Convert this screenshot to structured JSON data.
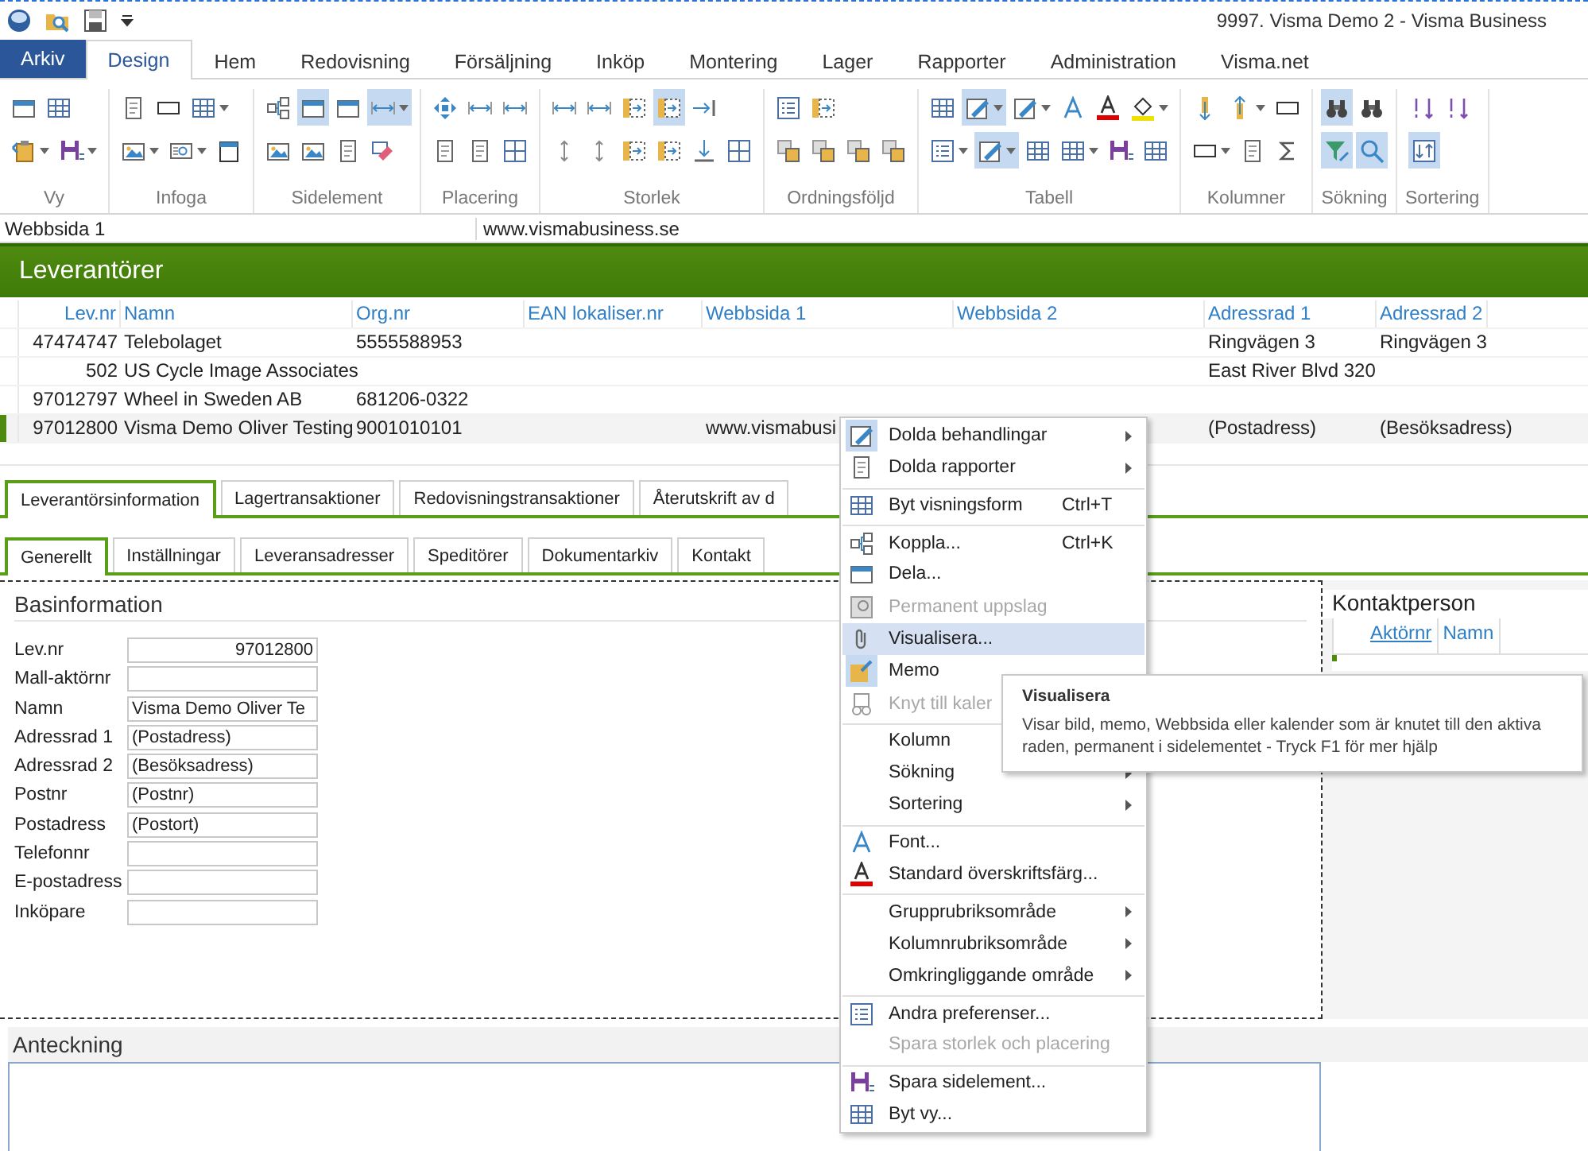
{
  "window": {
    "title": "9997. Visma Demo 2 -  Visma Business"
  },
  "file_tab": {
    "label": "Arkiv"
  },
  "tabs": [
    {
      "label": "Design",
      "selected": true
    },
    {
      "label": "Hem",
      "selected": false
    },
    {
      "label": "Redovisning",
      "selected": false
    },
    {
      "label": "Försäljning",
      "selected": false
    },
    {
      "label": "Inköp",
      "selected": false
    },
    {
      "label": "Montering",
      "selected": false
    },
    {
      "label": "Lager",
      "selected": false
    },
    {
      "label": "Rapporter",
      "selected": false
    },
    {
      "label": "Administration",
      "selected": false
    },
    {
      "label": "Visma.net",
      "selected": false
    }
  ],
  "ribbon": {
    "groups": [
      {
        "label": "Vy",
        "top": [
          {
            "on": false
          },
          {
            "on": false
          }
        ],
        "bottom": [
          {
            "on": false
          },
          {
            "on": false
          }
        ]
      },
      {
        "label": "Infoga",
        "top": [
          {
            "on": false
          },
          {
            "on": false
          },
          {
            "on": false
          }
        ],
        "bottom": [
          {
            "on": false
          },
          {
            "on": false
          },
          {
            "on": false
          }
        ]
      },
      {
        "label": "Sidelement",
        "top": [
          {
            "on": false
          },
          {
            "on": true
          },
          {
            "on": false
          },
          {
            "on": true
          }
        ],
        "bottom": [
          {
            "on": false
          },
          {
            "on": false
          },
          {
            "on": false
          },
          {
            "on": false
          }
        ]
      },
      {
        "label": "Placering",
        "top": [
          {
            "on": false
          },
          {
            "on": false
          },
          {
            "on": false
          }
        ],
        "bottom": [
          {
            "on": false
          },
          {
            "on": false
          },
          {
            "on": false
          }
        ]
      },
      {
        "label": "Storlek",
        "top": [
          {
            "on": false
          },
          {
            "on": false
          },
          {
            "on": false
          },
          {
            "on": true
          },
          {
            "on": false
          }
        ],
        "bottom": [
          {
            "on": false
          },
          {
            "on": false
          },
          {
            "on": false
          },
          {
            "on": false
          },
          {
            "on": false
          },
          {
            "on": false
          }
        ]
      },
      {
        "label": "Ordningsföljd",
        "top": [
          {
            "on": false
          },
          {
            "on": false
          }
        ],
        "bottom": [
          {
            "on": false
          },
          {
            "on": false
          },
          {
            "on": false
          },
          {
            "on": false
          }
        ]
      },
      {
        "label": "Tabell",
        "top": [
          {
            "on": false
          },
          {
            "on": true
          },
          {
            "on": false
          },
          {
            "on": false
          },
          {
            "on": false
          },
          {
            "on": false
          }
        ],
        "bottom": [
          {
            "on": false
          },
          {
            "on": true
          },
          {
            "on": false
          },
          {
            "on": false
          },
          {
            "on": false
          },
          {
            "on": false
          }
        ]
      },
      {
        "label": "Kolumner",
        "top": [
          {
            "on": false
          },
          {
            "on": false
          },
          {
            "on": false
          }
        ],
        "bottom": [
          {
            "on": false
          },
          {
            "on": false
          },
          {
            "on": false
          }
        ]
      },
      {
        "label": "Sökning",
        "top": [
          {
            "on": true
          },
          {
            "on": false
          }
        ],
        "bottom": [
          {
            "on": true
          },
          {
            "on": true
          }
        ]
      },
      {
        "label": "Sortering",
        "top": [
          {
            "on": false
          },
          {
            "on": false
          }
        ],
        "bottom": [
          {
            "on": true
          }
        ]
      }
    ]
  },
  "field_bar": {
    "label": "Webbsida 1",
    "value": "www.vismabusiness.se"
  },
  "section_title": "Leverantörer",
  "table": {
    "columns": [
      "Lev.nr",
      "Namn",
      "Org.nr",
      "EAN lokaliser.nr",
      "Webbsida 1",
      "Webbsida 2",
      "Adressrad 1",
      "Adressrad 2"
    ],
    "rows": [
      {
        "selected": false,
        "cells": [
          "47474747",
          "Telebolaget",
          "5555588953",
          null,
          null,
          null,
          "Ringvägen 3",
          "Ringvägen 3"
        ]
      },
      {
        "selected": false,
        "cells": [
          "502",
          "US Cycle Image Associates",
          null,
          null,
          null,
          null,
          "East River Blvd 320",
          null
        ]
      },
      {
        "selected": false,
        "cells": [
          "97012797",
          "Wheel in Sweden AB",
          "681206-0322",
          null,
          null,
          null,
          null,
          null
        ]
      },
      {
        "selected": true,
        "cells": [
          "97012800",
          "Visma Demo Oliver Testing",
          "9001010101",
          null,
          "www.vismabusi",
          null,
          "(Postadress)",
          "(Besöksadress)"
        ]
      }
    ]
  },
  "info_tabs": [
    {
      "label": "Leverantörsinformation",
      "selected": true
    },
    {
      "label": "Lagertransaktioner",
      "selected": false
    },
    {
      "label": "Redovisningstransaktioner",
      "selected": false
    },
    {
      "label": "Återutskrift av d",
      "selected": false
    }
  ],
  "sub_tabs": [
    {
      "label": "Generellt",
      "selected": true
    },
    {
      "label": "Inställningar",
      "selected": false
    },
    {
      "label": "Leveransadresser",
      "selected": false
    },
    {
      "label": "Speditörer",
      "selected": false
    },
    {
      "label": "Dokumentarkiv",
      "selected": false
    },
    {
      "label": "Kontakt",
      "selected": false
    }
  ],
  "basinformation": {
    "title": "Basinformation",
    "fields": [
      {
        "label": "Lev.nr",
        "value": "97012800",
        "kind": "number"
      },
      {
        "label": "Mall-aktörnr",
        "kind": "text"
      },
      {
        "label": "Namn",
        "value": "Visma Demo Oliver Te",
        "kind": "text"
      },
      {
        "label": "Adressrad 1",
        "value": "(Postadress)",
        "kind": "text"
      },
      {
        "label": "Adressrad 2",
        "value": "(Besöksadress)",
        "kind": "text"
      },
      {
        "label": "Postnr",
        "value": "(Postnr)",
        "kind": "text"
      },
      {
        "label": "Postadress",
        "value": "(Postort)",
        "kind": "text"
      },
      {
        "label": "Telefonnr",
        "kind": "text"
      },
      {
        "label": "E-postadress",
        "kind": "text"
      },
      {
        "label": "Inköpare",
        "kind": "text"
      }
    ]
  },
  "contact": {
    "title": "Kontaktperson",
    "columns": [
      {
        "label": "Aktörnr",
        "link": true
      },
      {
        "label": "Namn",
        "link": false
      }
    ]
  },
  "notes": {
    "title": "Anteckning"
  },
  "context_menu": {
    "items": [
      {
        "label": "Dolda behandlingar",
        "submenu": true,
        "disabled": false,
        "selected": false,
        "checked": true,
        "separator": false
      },
      {
        "label": "Dolda rapporter",
        "submenu": true,
        "disabled": false,
        "selected": false,
        "checked": false,
        "separator": false
      },
      {
        "label": "Byt visningsform",
        "shortcut": "Ctrl+T",
        "submenu": false,
        "disabled": false,
        "selected": false,
        "checked": false,
        "separator": true
      },
      {
        "label": "Koppla...",
        "shortcut": "Ctrl+K",
        "submenu": false,
        "disabled": false,
        "selected": false,
        "checked": false,
        "separator": true
      },
      {
        "label": "Dela...",
        "submenu": false,
        "disabled": false,
        "selected": false,
        "checked": false,
        "separator": false
      },
      {
        "label": "Permanent uppslag",
        "submenu": false,
        "disabled": true,
        "selected": false,
        "checked": false,
        "separator": false
      },
      {
        "label": "Visualisera...",
        "submenu": false,
        "disabled": false,
        "selected": true,
        "checked": false,
        "separator": false
      },
      {
        "label": "Memo",
        "submenu": false,
        "disabled": false,
        "selected": false,
        "checked": true,
        "separator": false
      },
      {
        "label": "Knyt till kaler",
        "submenu": false,
        "disabled": true,
        "selected": false,
        "checked": false,
        "separator": false
      },
      {
        "label": "Kolumn",
        "submenu": false,
        "disabled": false,
        "selected": false,
        "checked": false,
        "separator": true
      },
      {
        "label": "Sökning",
        "submenu": true,
        "disabled": false,
        "selected": false,
        "checked": false,
        "separator": false
      },
      {
        "label": "Sortering",
        "submenu": true,
        "disabled": false,
        "selected": false,
        "checked": false,
        "separator": false
      },
      {
        "label": "Font...",
        "submenu": false,
        "disabled": false,
        "selected": false,
        "checked": false,
        "separator": true
      },
      {
        "label": "Standard överskriftsfärg...",
        "submenu": false,
        "disabled": false,
        "selected": false,
        "checked": false,
        "separator": false
      },
      {
        "label": "Grupprubriksområde",
        "submenu": true,
        "disabled": false,
        "selected": false,
        "checked": false,
        "separator": true
      },
      {
        "label": "Kolumnrubriksområde",
        "submenu": true,
        "disabled": false,
        "selected": false,
        "checked": false,
        "separator": false
      },
      {
        "label": "Omkringliggande område",
        "submenu": true,
        "disabled": false,
        "selected": false,
        "checked": false,
        "separator": false
      },
      {
        "label": "Andra preferenser...",
        "submenu": false,
        "disabled": false,
        "selected": false,
        "checked": false,
        "separator": true
      },
      {
        "label": "Spara storlek och placering",
        "submenu": false,
        "disabled": true,
        "selected": false,
        "checked": false,
        "separator": false
      },
      {
        "label": "Spara sidelement...",
        "submenu": false,
        "disabled": false,
        "selected": false,
        "checked": false,
        "separator": true
      },
      {
        "label": "Byt vy...",
        "submenu": false,
        "disabled": false,
        "selected": false,
        "checked": false,
        "separator": false
      }
    ]
  },
  "tooltip": {
    "title": "Visualisera",
    "text": "Visar bild, memo, Webbsida eller kalender som är knutet till den aktiva raden, permanent i sidelementet - Tryck F1 för mer hjälp"
  }
}
